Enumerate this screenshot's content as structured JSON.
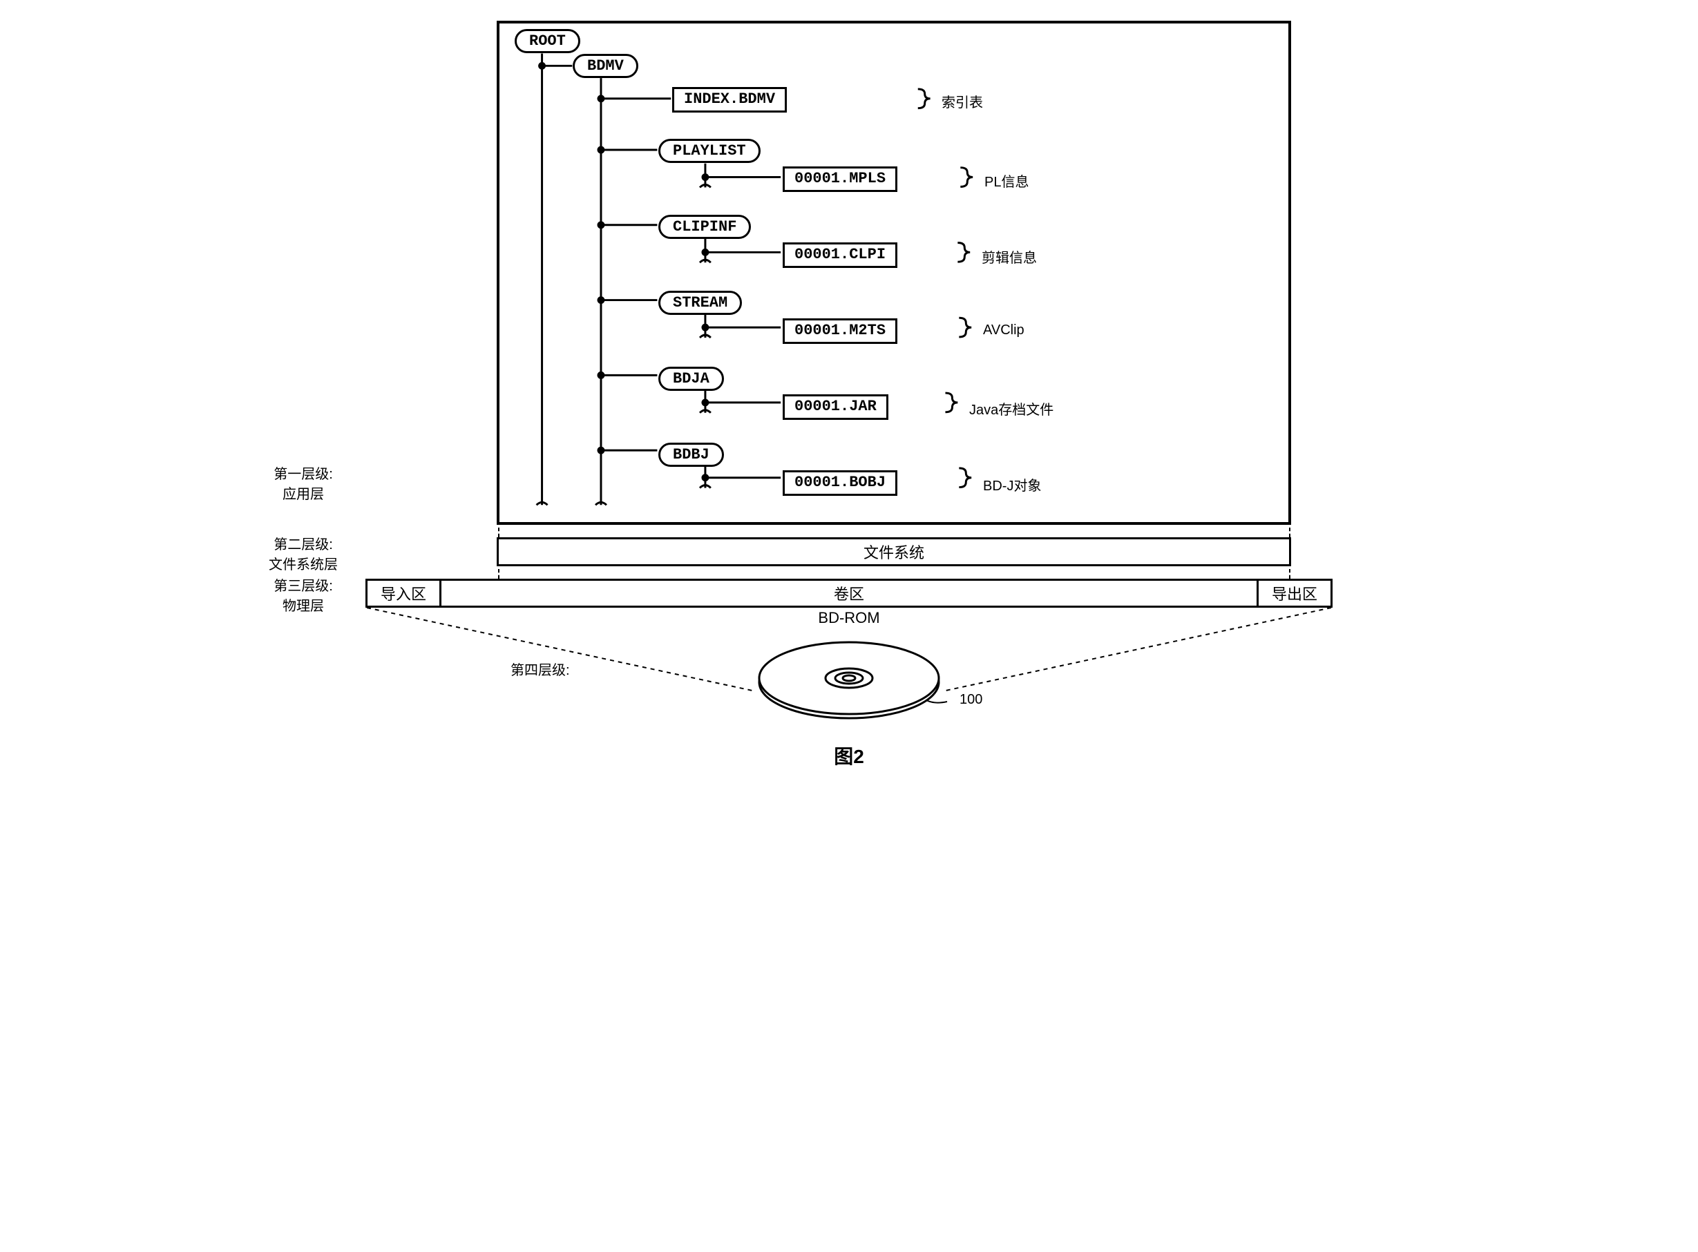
{
  "layers": {
    "first": {
      "label_line1": "第一层级:",
      "label_line2": "应用层"
    },
    "second": {
      "label_line1": "第二层级:",
      "label_line2": "文件系统层"
    },
    "third": {
      "label_line1": "第三层级:",
      "label_line2": "物理层"
    },
    "fourth": {
      "label": "第四层级:"
    }
  },
  "tree": {
    "root": "ROOT",
    "bdmv": "BDMV",
    "index_file": "INDEX.BDMV",
    "index_annot": "索引表",
    "playlist_dir": "PLAYLIST",
    "playlist_file": "00001.MPLS",
    "playlist_annot": "PL信息",
    "clipinf_dir": "CLIPINF",
    "clipinf_file": "00001.CLPI",
    "clipinf_annot": "剪辑信息",
    "stream_dir": "STREAM",
    "stream_file": "00001.M2TS",
    "stream_annot": "AVClip",
    "bdja_dir": "BDJA",
    "bdja_file": "00001.JAR",
    "bdja_annot": "Java存档文件",
    "bdbj_dir": "BDBJ",
    "bdbj_file": "00001.BOBJ",
    "bdbj_annot": "BD-J对象"
  },
  "fs_layer_label": "文件系统",
  "phys": {
    "leadin": "导入区",
    "volume": "卷区",
    "leadout": "导出区",
    "bdrom": "BD-ROM"
  },
  "disc_ref": "100",
  "figure_title": "图2"
}
